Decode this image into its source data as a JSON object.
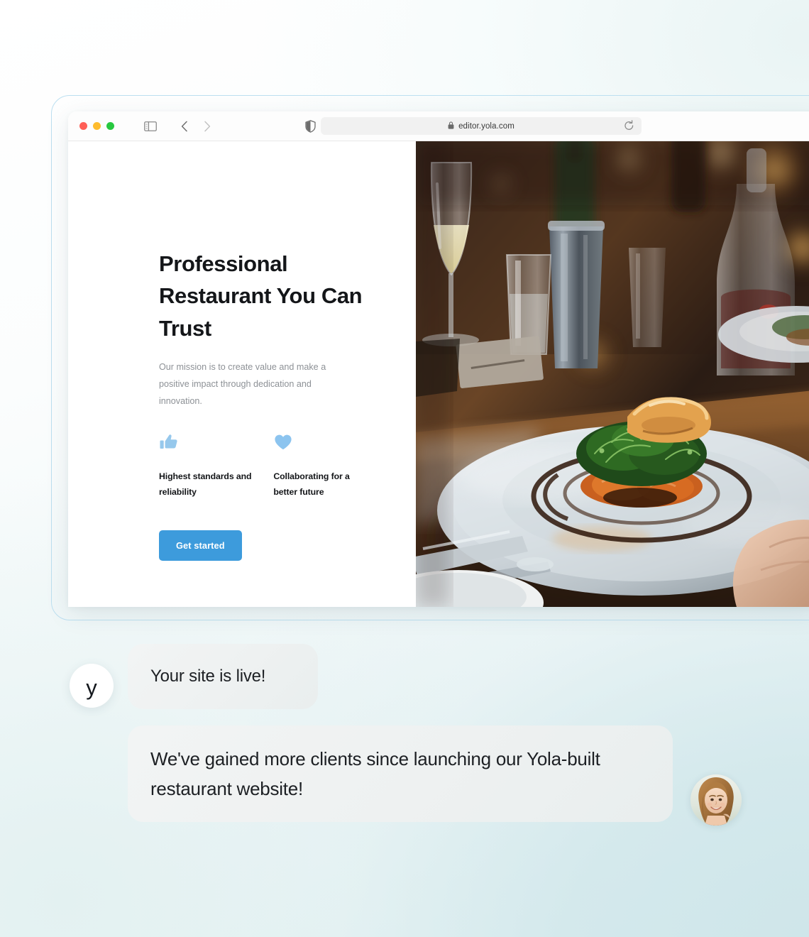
{
  "background": {
    "accent_blue": "#bcdff0",
    "wash_from": "#ffffff",
    "wash_to": "#dceef0"
  },
  "browser": {
    "traffic_lights": [
      {
        "name": "close",
        "color": "#ff5f57"
      },
      {
        "name": "minimize",
        "color": "#febc2e"
      },
      {
        "name": "maximize",
        "color": "#28c840"
      }
    ],
    "sidebar_toggle_icon": "sidebar-icon",
    "back_icon": "chevron-left-icon",
    "forward_icon": "chevron-right-icon",
    "shield_icon": "shield-icon",
    "lock_icon": "lock-icon",
    "reload_icon": "reload-icon",
    "url": "editor.yola.com"
  },
  "site": {
    "heading": "Professional Restaurant You Can Trust",
    "subheading": "Our mission is to create value and make a positive impact through dedication and innovation.",
    "features": [
      {
        "icon": "thumbs-up-icon",
        "label": "Highest standards and reliability"
      },
      {
        "icon": "heart-icon",
        "label": "Collaborating for a better future"
      }
    ],
    "cta_label": "Get started",
    "cta_color": "#3d9bdc",
    "feature_icon_color": "#96c8ec",
    "photo_alt": "plated-fish-dish-restaurant-table"
  },
  "chat": {
    "brand_avatar_letter": "y",
    "messages": [
      {
        "from": "brand",
        "text": "Your site is live!"
      },
      {
        "from": "customer",
        "text": "We've gained more clients since launching our Yola-built restaurant website!"
      }
    ],
    "customer_avatar_alt": "smiling-woman-portrait"
  }
}
